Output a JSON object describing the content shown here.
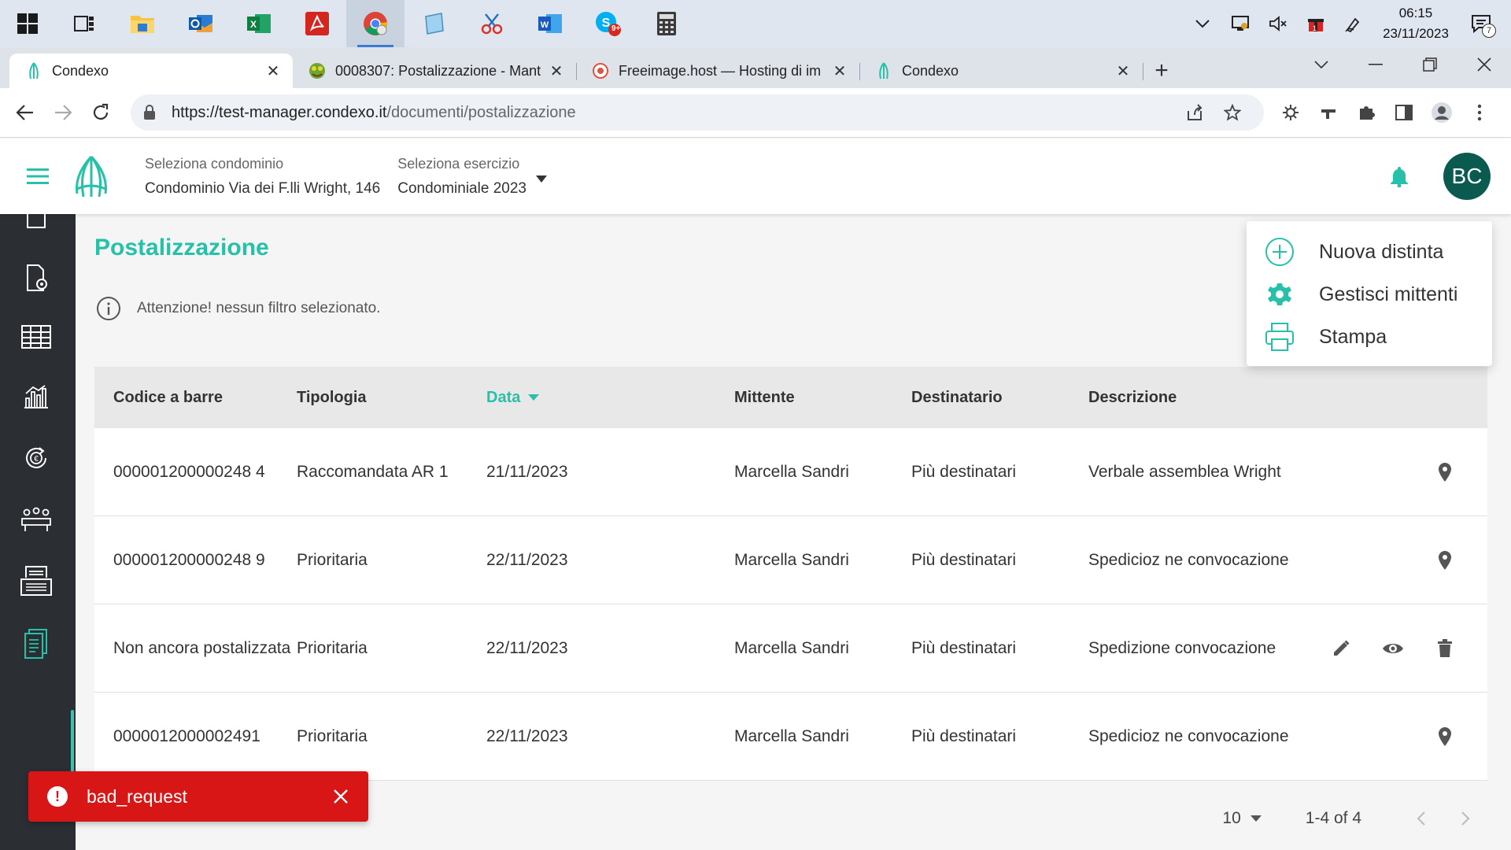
{
  "taskbar": {
    "apps": [
      "task-view",
      "file-explorer",
      "outlook",
      "excel",
      "acrobat",
      "chrome",
      "notepad",
      "snipping-tool",
      "word",
      "skype",
      "calculator"
    ],
    "skype_badge": "9+",
    "clock_time": "06:15",
    "clock_date": "23/11/2023",
    "notifications_count": "7"
  },
  "browser": {
    "tabs": [
      {
        "title": "Condexo",
        "active": true
      },
      {
        "title": "0008307: Postalizzazione - Mant",
        "active": false
      },
      {
        "title": "Freeimage.host — Hosting di im",
        "active": false
      },
      {
        "title": "Condexo",
        "active": false
      }
    ],
    "url_host": "https://test-manager.condexo.it",
    "url_path": "/documenti/postalizzazione"
  },
  "header": {
    "condominio_label": "Seleziona condominio",
    "condominio_value": "Condominio Via dei F.lli Wright, 146",
    "esercizio_label": "Seleziona esercizio",
    "esercizio_value": "Condominiale 2023",
    "avatar_initials": "BC",
    "accent_color": "#27c0a8"
  },
  "page": {
    "title": "Postalizzazione",
    "alert": "Attenzione! nessun filtro selezionato."
  },
  "table": {
    "columns": [
      "Codice a barre",
      "Tipologia",
      "Data",
      "Mittente",
      "Destinatario",
      "Descrizione"
    ],
    "sorted_column": "Data",
    "rows": [
      {
        "codice": "000001200000248 4",
        "tipologia": "Raccomandata AR 1",
        "data": "21/11/2023",
        "mittente": "Marcella Sandri",
        "destinatario": "Più destinatari",
        "descrizione": "Verbale assemblea Wright",
        "actions": [
          "location-icon"
        ]
      },
      {
        "codice": "000001200000248 9",
        "tipologia": "Prioritaria",
        "data": "22/11/2023",
        "mittente": "Marcella Sandri",
        "destinatario": "Più destinatari",
        "descrizione": "Spedicioz ne convocazione",
        "actions": [
          "location-icon"
        ]
      },
      {
        "codice": "Non ancora postalizzata",
        "tipologia": "Prioritaria",
        "data": "22/11/2023",
        "mittente": "Marcella Sandri",
        "destinatario": "Più destinatari",
        "descrizione": "Spedizione convocazione",
        "actions": [
          "edit-icon",
          "eye-icon",
          "trash-icon"
        ]
      },
      {
        "codice": "0000012000002491",
        "tipologia": "Prioritaria",
        "data": "22/11/2023",
        "mittente": "Marcella Sandri",
        "destinatario": "Più destinatari",
        "descrizione": "Spedicioz ne convocazione",
        "actions": [
          "location-icon"
        ]
      }
    ]
  },
  "pager": {
    "page_size": "10",
    "range": "1-4 of 4"
  },
  "menu": {
    "items": [
      "Nuova distinta",
      "Gestisci mittenti",
      "Stampa"
    ]
  },
  "toast": {
    "message": "bad_request",
    "color": "#d91616"
  }
}
